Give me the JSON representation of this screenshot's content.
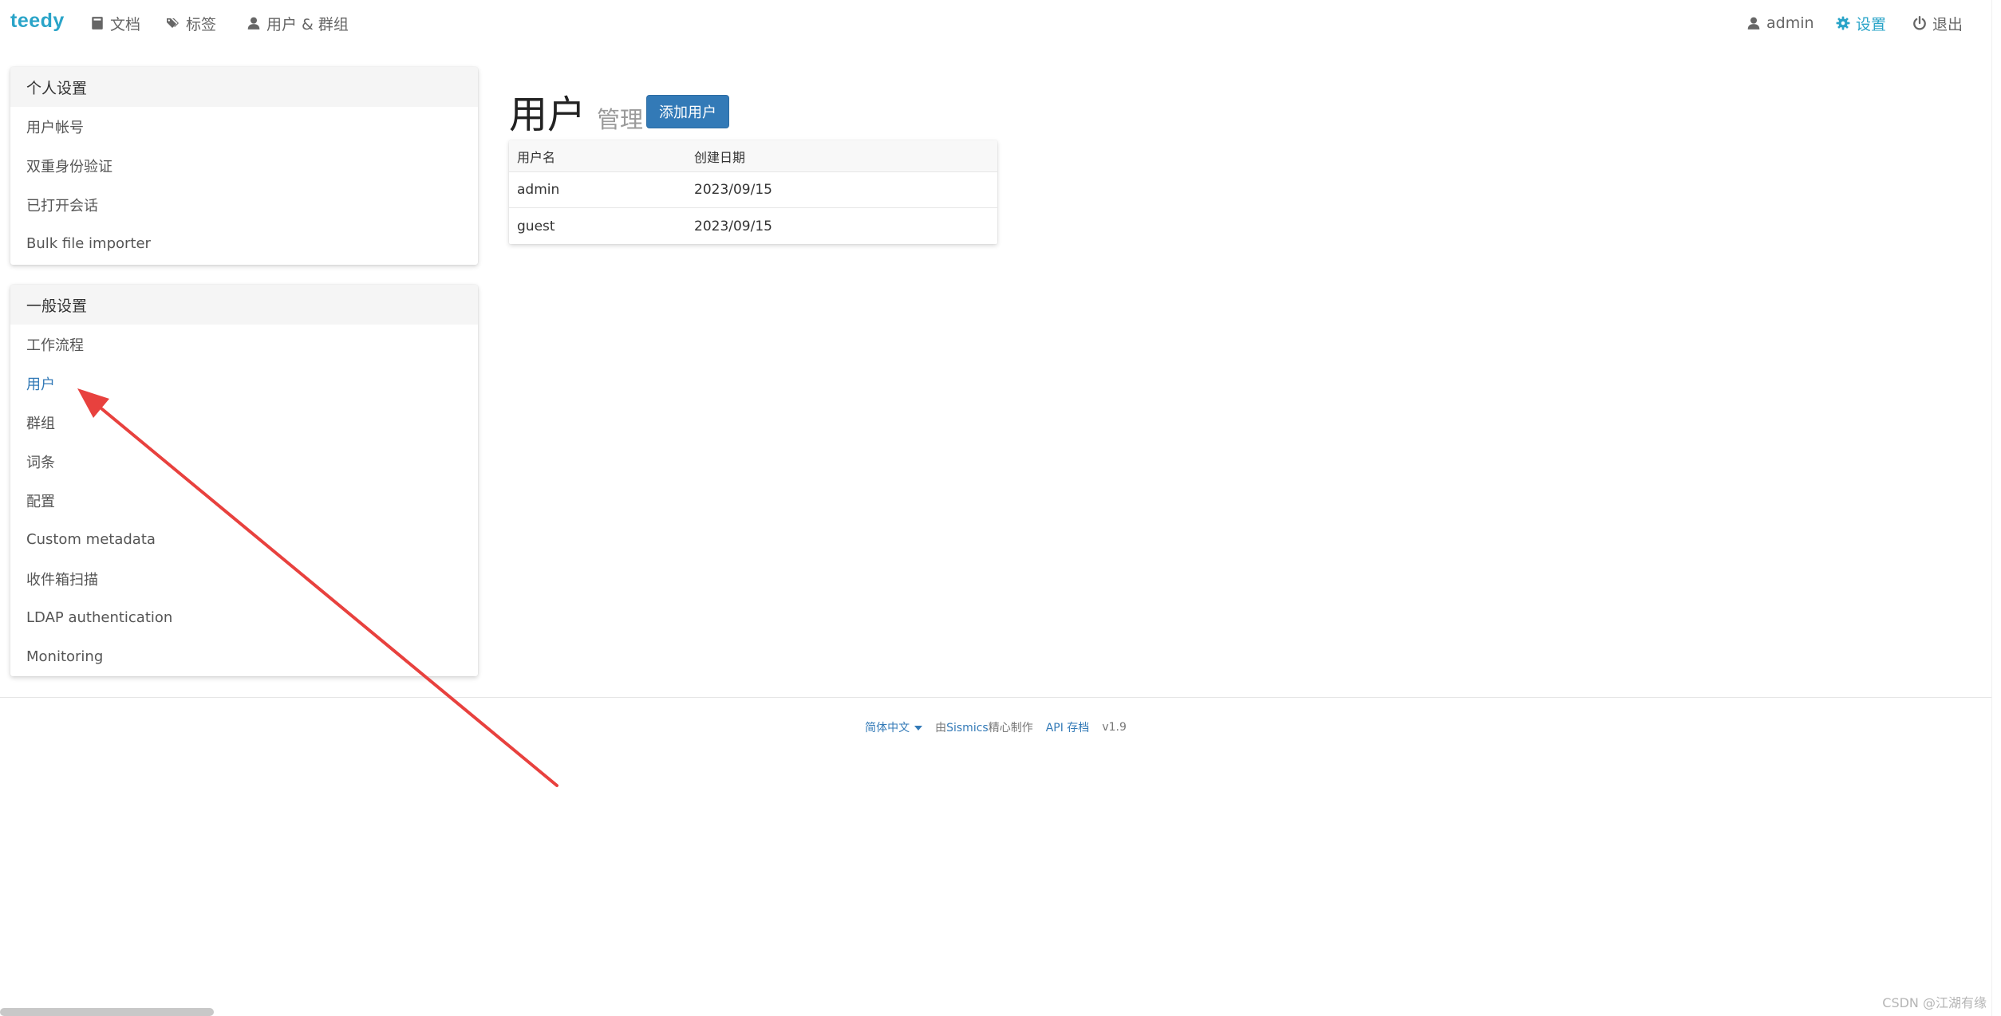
{
  "navbar": {
    "brand": "teedy",
    "documents": "文档",
    "tags": "标签",
    "users_groups": "用户 & 群组",
    "account": "admin",
    "settings": "设置",
    "logout": "退出"
  },
  "sidebar": {
    "personal_heading": "个人设置",
    "personal_items": [
      "用户帐号",
      "双重身份验证",
      "已打开会话",
      "Bulk file importer"
    ],
    "general_heading": "一般设置",
    "general_items": [
      "工作流程",
      "用户",
      "群组",
      "词条",
      "配置",
      "Custom metadata",
      "收件箱扫描",
      "LDAP authentication",
      "Monitoring"
    ],
    "active_item": "用户"
  },
  "main": {
    "title": "用户",
    "subtitle": "管理",
    "add_button": "添加用户",
    "table": {
      "headers": [
        "用户名",
        "创建日期"
      ],
      "rows": [
        [
          "admin",
          "2023/09/15"
        ],
        [
          "guest",
          "2023/09/15"
        ]
      ]
    }
  },
  "footer": {
    "language": "简体中文",
    "made_by_prefix": "由",
    "made_by_link": "Sismics",
    "made_by_suffix": "精心制作",
    "api_docs": "API 存档",
    "version": "v1.9"
  },
  "watermark": "CSDN @江湖有缘",
  "colors": {
    "brand": "#2aa4c8",
    "primary": "#337ab7",
    "annotation_arrow": "#e8413e"
  },
  "icons": {
    "documents": "book-icon",
    "tags": "tags-icon",
    "users_groups": "user-icon",
    "account": "user-icon",
    "settings": "gear-icon",
    "logout": "power-icon"
  }
}
